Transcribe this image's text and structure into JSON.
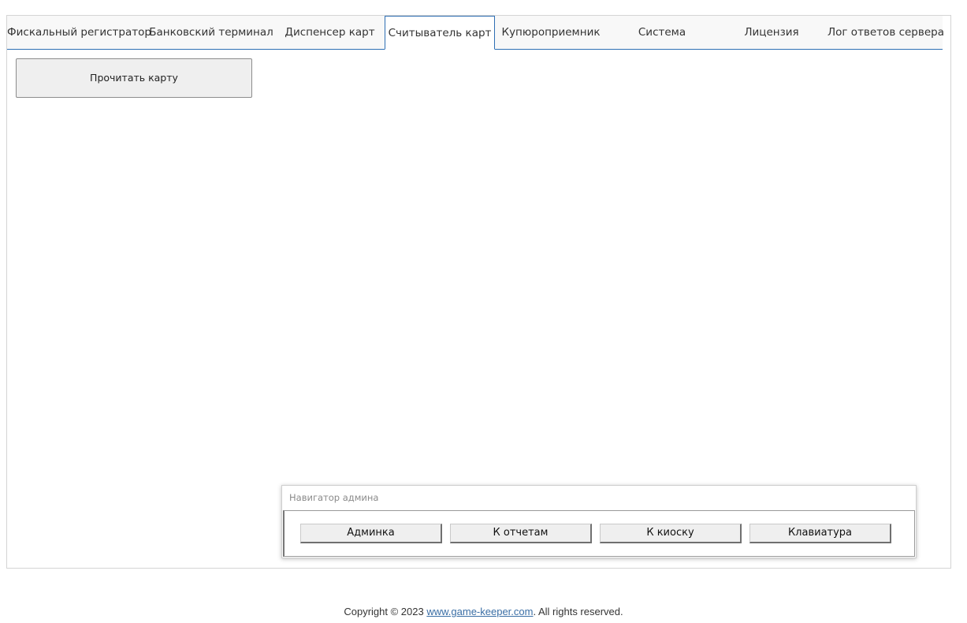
{
  "tabs": [
    {
      "label": "Фискальный регистратор",
      "active": false
    },
    {
      "label": "Банковский терминал",
      "active": false
    },
    {
      "label": "Диспенсер карт",
      "active": false
    },
    {
      "label": "Считыватель карт",
      "active": true
    },
    {
      "label": "Купюроприемник",
      "active": false
    },
    {
      "label": "Система",
      "active": false
    },
    {
      "label": "Лицензия",
      "active": false
    },
    {
      "label": "Лог ответов сервера",
      "active": false
    }
  ],
  "card_reader": {
    "read_card_label": "Прочитать карту"
  },
  "admin_navigator": {
    "title": "Навигатор админа",
    "buttons": [
      "Админка",
      "К отчетам",
      "К киоску",
      "Клавиатура"
    ]
  },
  "footer": {
    "prefix": "Copyright © 2023 ",
    "link_text": "www.game-keeper.com",
    "suffix": ". All rights reserved."
  },
  "colors": {
    "accent": "#2e6fb4",
    "link": "#3a6ea5",
    "button_bg": "#efefef"
  }
}
